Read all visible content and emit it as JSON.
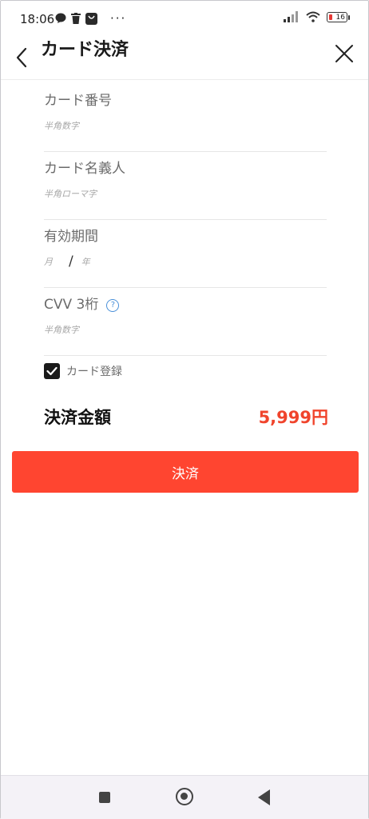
{
  "status_bar": {
    "time": "18:06",
    "battery": "16"
  },
  "header": {
    "title": "カード決済"
  },
  "form": {
    "card_number_label": "カード番号",
    "card_number_placeholder": "半角数字",
    "card_name_label": "カード名義人",
    "card_name_placeholder": "半角ローマ字",
    "expiry_label": "有効期間",
    "expiry_month_placeholder": "月",
    "expiry_separator": "/",
    "expiry_year_placeholder": "年",
    "cvv_label": "CVV 3桁",
    "cvv_help": "?",
    "cvv_placeholder": "半角数字",
    "save_card_label": "カード登録",
    "save_card_checked": true
  },
  "amount": {
    "label": "決済金額",
    "value": "5,999円"
  },
  "pay_button": {
    "label": "決済"
  },
  "colors": {
    "accent": "#ff4530",
    "price": "#f0442c",
    "help": "#4a90d9"
  }
}
